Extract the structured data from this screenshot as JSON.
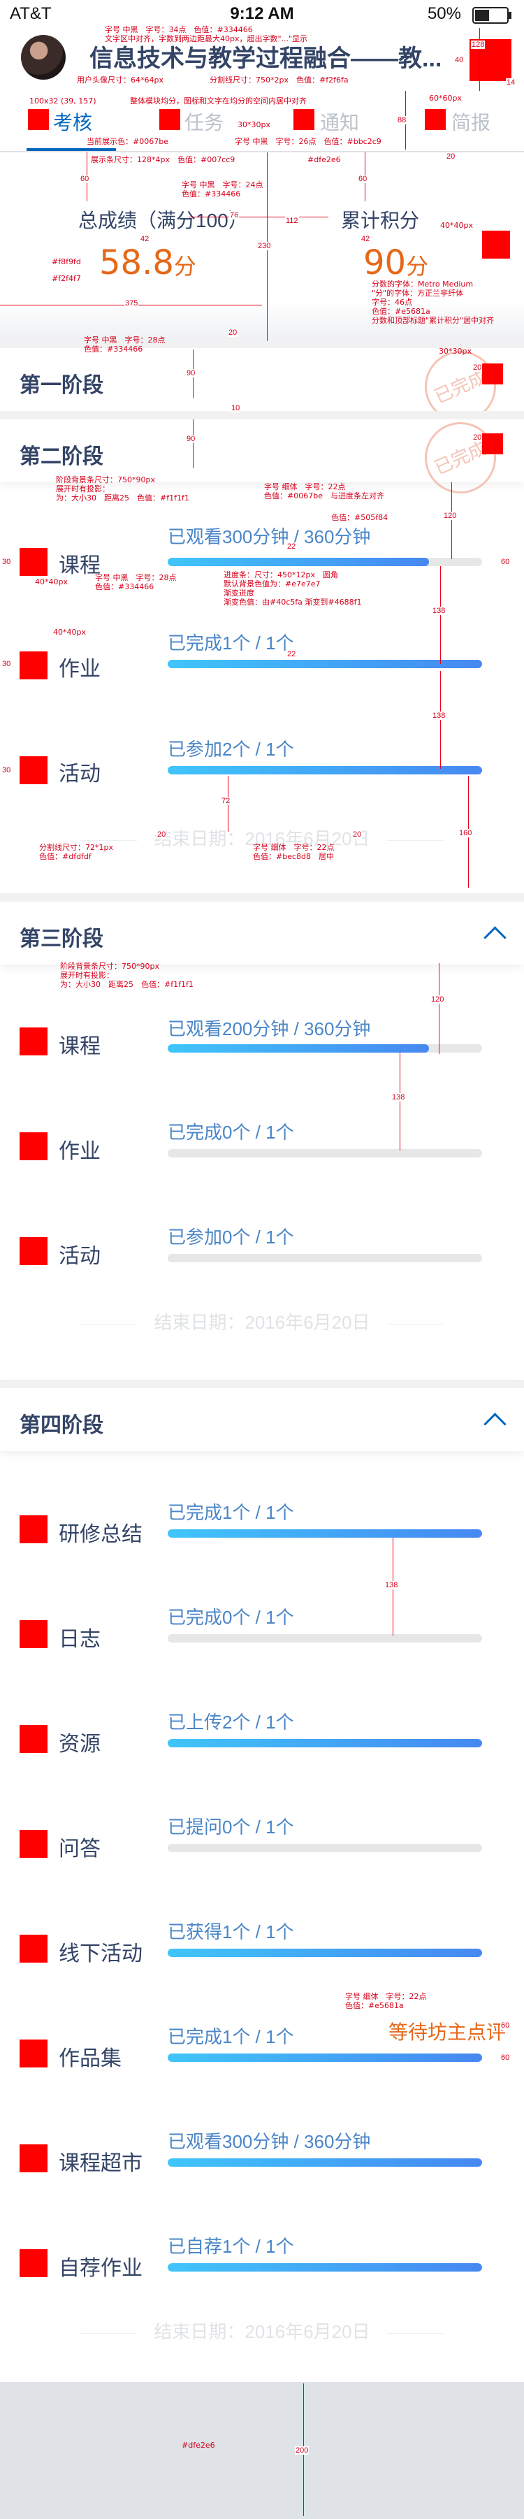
{
  "status_bar": {
    "carrier": "AT&T",
    "time": "9:12 AM",
    "battery": "50%",
    "battery_level": 0.5
  },
  "header": {
    "course_title": "信息技术与教学过程融合——教..."
  },
  "tabs": [
    {
      "label": "考核",
      "active": true
    },
    {
      "label": "任务",
      "active": false
    },
    {
      "label": "通知",
      "active": false
    },
    {
      "label": "简报",
      "active": false
    }
  ],
  "summary": {
    "total_label": "总成绩（满分100）",
    "total_value": "58.8",
    "total_unit": "分",
    "points_label": "累计积分",
    "points_value": "90",
    "points_unit": "分"
  },
  "stages": {
    "stage1": {
      "title": "第一阶段",
      "stamp": "已完成"
    },
    "stage2": {
      "title": "第二阶段",
      "stamp": "已完成",
      "end_date": "结束日期：2016年6月20日",
      "tasks": [
        {
          "name": "课程",
          "status": "已观看300分钟 / 360分钟",
          "progress": 0.83
        },
        {
          "name": "作业",
          "status": "已完成1个 / 1个",
          "progress": 1.0
        },
        {
          "name": "活动",
          "status": "已参加2个 / 1个",
          "progress": 1.0
        }
      ]
    },
    "stage3": {
      "title": "第三阶段",
      "end_date": "结束日期：2016年6月20日",
      "tasks": [
        {
          "name": "课程",
          "status": "已观看200分钟 / 360分钟",
          "progress": 0.83
        },
        {
          "name": "作业",
          "status": "已完成0个 / 1个",
          "progress": 0
        },
        {
          "name": "活动",
          "status": "已参加0个 / 1个",
          "progress": 0
        }
      ]
    },
    "stage4": {
      "title": "第四阶段",
      "end_date": "结束日期：2016年6月20日",
      "tasks": [
        {
          "name": "研修总结",
          "status": "已完成1个 / 1个",
          "progress": 1.0
        },
        {
          "name": "日志",
          "status": "已完成0个 / 1个",
          "progress": 0
        },
        {
          "name": "资源",
          "status": "已上传2个 / 1个",
          "progress": 1.0
        },
        {
          "name": "问答",
          "status": "已提问0个 / 1个",
          "progress": 0
        },
        {
          "name": "线下活动",
          "status": "已获得1个 / 1个",
          "progress": 1.0
        },
        {
          "name": "作品集",
          "status": "已完成1个 / 1个",
          "progress": 1.0,
          "note": "等待坊主点评"
        },
        {
          "name": "课程超市",
          "status": "已观看300分钟 / 360分钟",
          "progress": 1.0
        },
        {
          "name": "自荐作业",
          "status": "已自荐1个 / 1个",
          "progress": 1.0
        }
      ]
    }
  },
  "annotations": {
    "a_title_font": "字号 中黑　字号：34点　色值：#334466\n文字区中对齐，字数到两边距最大40px，超出字数\"...\"显示",
    "a_avatar": "用户头像尺寸：64*64px",
    "a_divider": "分割线尺寸：750*2px　色值：#f2f6fa",
    "a_tab_icon": "100x32 (39, 157)",
    "a_tab_note": "整体模块均分，图标和文字在均分的空间内居中对齐",
    "a_tab_active": "当前展示色：#0067be",
    "a_tab_text": "字号 中黑　字号：26点　色值：#bbc2c9",
    "a_tab_size": "30*30px",
    "a_underline": "展示条尺寸：128*4px　色值：#007cc9",
    "a_hdr_red": "60*60px",
    "a_dfe": "#dfe2e6",
    "a_score_font": "字号 中黑　字号：24点\n色值：#334466",
    "a_sq1": "#f8f9fd",
    "a_sq2": "#f2f4f7",
    "a_stamp_size": "40*40px",
    "a_score_num": "分数的字体：Metro Medium\n\"分\"的字体：方正兰亭纤体\n字号：46点\n色值：#e5681a\n分数和顶部标题\"累计积分\"居中对齐",
    "a_stage_font": "字号 中黑　字号：28点\n色值：#334466",
    "a_stage_bg": "阶段背景条尺寸：750*90px\n展开时有投影：\n为：大小30　距离25　色值：#f1f1f1",
    "a_bar": "字号 细体　字号：22点\n色值：#0067be　与进度条左对齐",
    "a_bar_color": "色值：#505f84",
    "a_bar_size": "进度条：尺寸：450*12px　圆角\n默认背景色值为：#e7e7e7\n渐变进度\n渐变色值：由#40c5fa 渐变到#4688f1",
    "a_task_font": "字号 中黑　字号：28点\n色值：#334466",
    "a_sep": "分割线尺寸：72*1px\n色值：#dfdfdf",
    "a_date": "字号 细体　字号：22点\n色值：#bec8d8　居中",
    "a_pending": "字号 细体　字号：22点\n色值：#e5681a",
    "a_stage3_bg": "阶段背景条尺寸：750*90px\n展开时有投影：\n为：大小30　距离25　色值：#f1f1f1",
    "d_128": "128",
    "d_40": "40",
    "d_14": "14",
    "d_88": "88",
    "d_20": "20",
    "d_60": "60",
    "d_76": "76",
    "d_112": "112",
    "d_230": "230",
    "d_42": "42",
    "d_375": "375",
    "d_90": "90",
    "d_10": "10",
    "d_120": "120",
    "d_30": "30",
    "d_22": "22",
    "d_138": "138",
    "d_72": "72",
    "d_160": "160",
    "d_200": "200"
  }
}
